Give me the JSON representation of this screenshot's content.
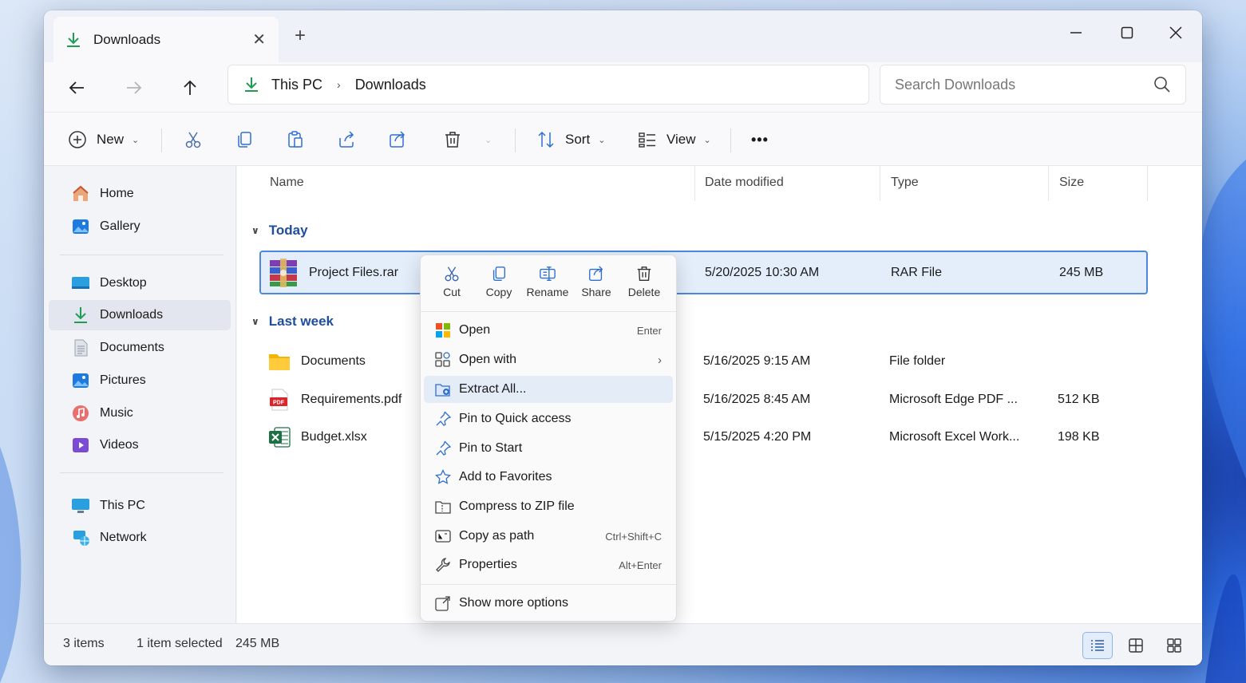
{
  "tab": {
    "title": "Downloads"
  },
  "address": {
    "crumbs": [
      "This PC",
      "Downloads"
    ]
  },
  "search": {
    "placeholder": "Search Downloads"
  },
  "commandbar": {
    "new_label": "New",
    "sort_label": "Sort",
    "view_label": "View",
    "more_label": "•••"
  },
  "sidebar": {
    "items": [
      {
        "label": "Home"
      },
      {
        "label": "Gallery"
      },
      {
        "label": "Desktop"
      },
      {
        "label": "Downloads"
      },
      {
        "label": "Documents"
      },
      {
        "label": "Pictures"
      },
      {
        "label": "Music"
      },
      {
        "label": "Videos"
      },
      {
        "label": "This PC"
      },
      {
        "label": "Network"
      }
    ]
  },
  "columns": {
    "name": "Name",
    "date": "Date modified",
    "type": "Type",
    "size": "Size"
  },
  "groups": {
    "today": "Today",
    "last_week": "Last week"
  },
  "files": [
    {
      "name": "Project Files.rar",
      "date": "5/20/2025 10:30 AM",
      "type": "RAR File",
      "size": "245 MB",
      "selected": true
    },
    {
      "name": "Documents",
      "date": "5/16/2025 9:15 AM",
      "type": "File folder",
      "size": ""
    },
    {
      "name": "Requirements.pdf",
      "date": "5/16/2025 8:45 AM",
      "type": "Microsoft Edge PDF ...",
      "size": "512 KB"
    },
    {
      "name": "Budget.xlsx",
      "date": "5/15/2025 4:20 PM",
      "type": "Microsoft Excel Work...",
      "size": "198 KB"
    }
  ],
  "status": {
    "items": "3 items",
    "selection": "1 item selected",
    "sel_size": "245 MB"
  },
  "context_menu": {
    "quick_actions": [
      {
        "label": "Cut"
      },
      {
        "label": "Copy"
      },
      {
        "label": "Rename"
      },
      {
        "label": "Share"
      },
      {
        "label": "Delete"
      }
    ],
    "items": [
      {
        "label": "Open",
        "shortcut": "Enter"
      },
      {
        "label": "Open with",
        "shortcut": ""
      },
      {
        "label": "Extract All...",
        "shortcut": "",
        "highlighted": true
      },
      {
        "label": "Pin to Quick access",
        "shortcut": ""
      },
      {
        "label": "Pin to Start",
        "shortcut": ""
      },
      {
        "label": "Add to Favorites",
        "shortcut": ""
      },
      {
        "label": "Compress to ZIP file",
        "shortcut": ""
      },
      {
        "label": "Copy as path",
        "shortcut": "Ctrl+Shift+C"
      },
      {
        "label": "Properties",
        "shortcut": "Alt+Enter"
      },
      {
        "label": "Show more options",
        "shortcut": ""
      }
    ]
  },
  "colors": {
    "accent": "#4a89dc",
    "download_green": "#1f9d55",
    "group_text": "#1f4e9c"
  },
  "icons": {
    "tab": "download-arrow-icon",
    "back": "arrow-left-icon",
    "forward": "arrow-right-icon",
    "up": "arrow-up-icon",
    "search": "magnifier-icon",
    "cut": "scissors-icon",
    "copy": "copy-icon",
    "paste": "paste-icon",
    "share": "share-icon",
    "delete": "trash-icon"
  }
}
